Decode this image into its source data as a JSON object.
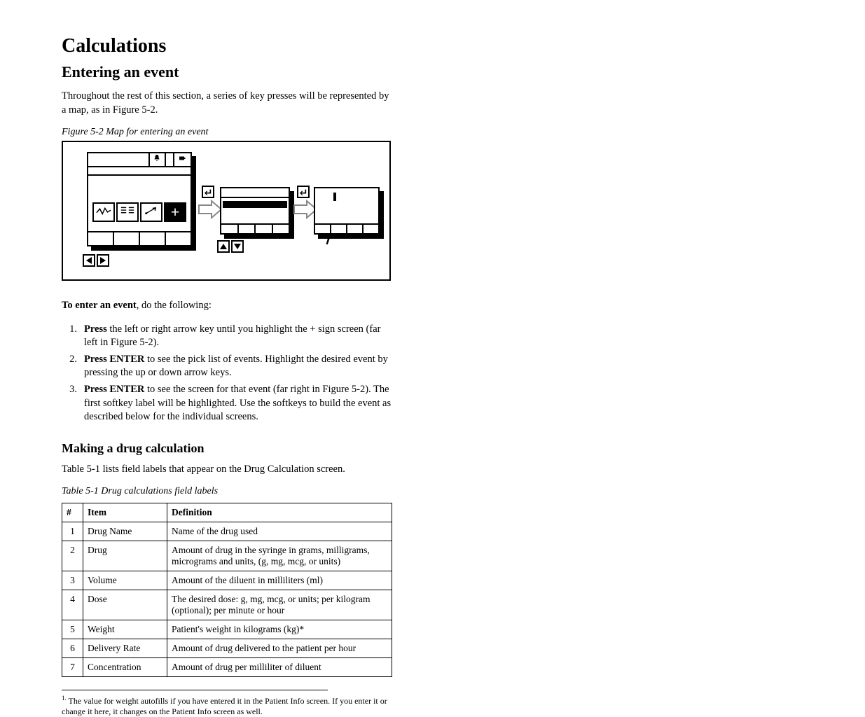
{
  "heading": "Calculations",
  "subtitle": "Entering an event",
  "intro": "Throughout the rest of this section, a series of key presses will be represented by a map, as in Figure 5-2.",
  "figure_caption": "Figure 5-2  Map for entering an event",
  "screen1": {
    "icons": {
      "bell": "bell-icon",
      "battery": "battery-icon"
    },
    "tabs": {
      "waveform": "waveform-icon",
      "list": "list-icon",
      "vector": "vector-icon",
      "plus": "+"
    }
  },
  "arrow1_key": "↵",
  "screen2": {
    "row_label": ""
  },
  "arrow2_key": "↵",
  "screen3": {
    "softkey_pointer": "↖"
  },
  "instruction_lead": "To enter an event",
  "instruction_tail": ", do the following:",
  "steps": [
    {
      "n": "1.",
      "lead": "Press",
      "body": " the left or right arrow key until you highlight the + sign screen (far left in Figure 5-2)."
    },
    {
      "n": "2.",
      "lead": "Press ENTER",
      "body": " to see the pick list of events. Highlight the desired event by pressing the up or down arrow keys."
    },
    {
      "n": "3.",
      "lead": "Press ENTER",
      "body": " to see the screen for that event (far right in Figure 5-2). The first softkey label will be highlighted. Use the softkeys to build the event as described below for the individual screens."
    }
  ],
  "sub_heading": "Making a drug calculation",
  "sub_para": "Table 5-1 lists field labels that appear on the Drug Calculation screen.",
  "table_caption": "Table 5-1  Drug calculations field labels",
  "table": {
    "headers": [
      "#",
      "Item",
      "Definition"
    ],
    "rows": [
      [
        "1",
        "Drug Name",
        "Name of the drug used"
      ],
      [
        "2",
        "Drug",
        "Amount of drug in the syringe in grams, milligrams, micrograms and units, (g, mg, mcg, or units)"
      ],
      [
        "3",
        "Volume",
        "Amount of the diluent in milliliters (ml)"
      ],
      [
        "4",
        "Dose",
        "The desired dose: g, mg, mcg, or units; per kilogram (optional); per minute or hour"
      ],
      [
        "5",
        "Weight",
        "Patient's weight in kilograms (kg)*"
      ],
      [
        "6",
        "Delivery Rate",
        "Amount of drug delivered to the patient per hour"
      ],
      [
        "7",
        "Concentration",
        "Amount of drug per milliliter of diluent"
      ]
    ]
  },
  "footnote_marker": "1.",
  "footnote": "The value for weight autofills if you have entered it in the Patient Info screen. If you enter it or change it here, it changes on the Patient Info screen as well."
}
